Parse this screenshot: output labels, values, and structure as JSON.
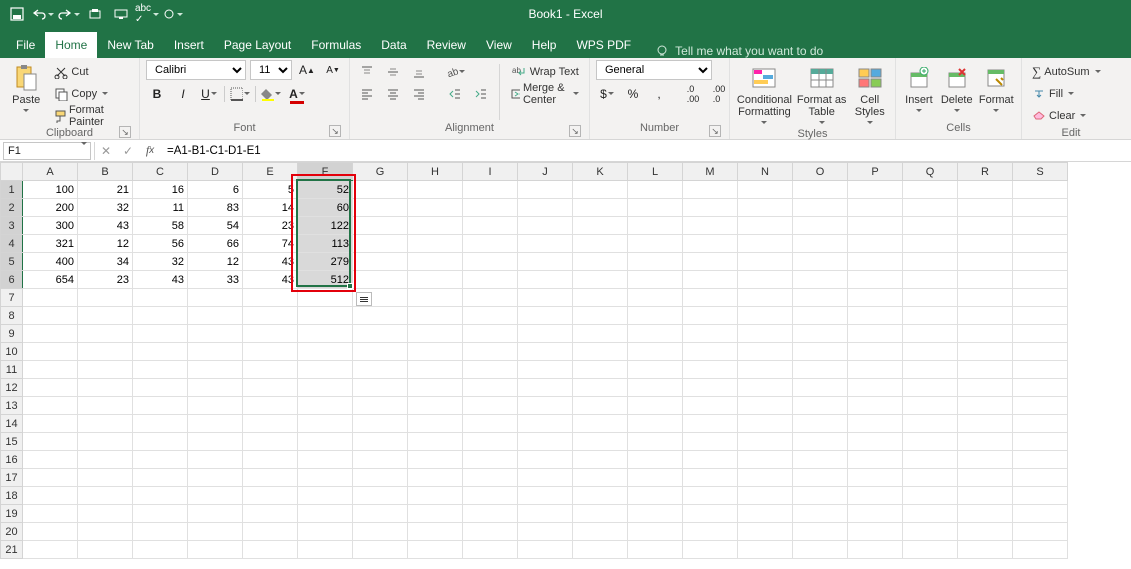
{
  "app": {
    "title": "Book1 - Excel"
  },
  "qat": {
    "save": "save-icon",
    "undo": "undo-icon",
    "redo": "redo-icon",
    "preview": "print-preview-icon",
    "device": "device-icon",
    "spellcheck": "spellcheck-icon",
    "touchmode": "touch-mode-icon"
  },
  "tabs": {
    "file": "File",
    "items": [
      "Home",
      "New Tab",
      "Insert",
      "Page Layout",
      "Formulas",
      "Data",
      "Review",
      "View",
      "Help",
      "WPS PDF"
    ],
    "active_index": 0,
    "tell_me": "Tell me what you want to do"
  },
  "ribbon": {
    "clipboard": {
      "label": "Clipboard",
      "paste": "Paste",
      "cut": "Cut",
      "copy": "Copy",
      "format_painter": "Format Painter"
    },
    "font": {
      "label": "Font",
      "name_value": "Calibri",
      "size_value": "11",
      "bold": "B",
      "italic": "I",
      "underline": "U"
    },
    "alignment": {
      "label": "Alignment",
      "wrap": "Wrap Text",
      "merge": "Merge & Center"
    },
    "number": {
      "label": "Number",
      "format_value": "General",
      "currency": "$",
      "percent": "%",
      "comma": ","
    },
    "styles": {
      "label": "Styles",
      "cond": "Conditional\nFormatting",
      "table": "Format as\nTable",
      "cell": "Cell\nStyles"
    },
    "cells": {
      "label": "Cells",
      "insert": "Insert",
      "delete": "Delete",
      "format": "Format"
    },
    "editing": {
      "label": "Edit",
      "autosum": "AutoSum",
      "fill": "Fill",
      "clear": "Clear"
    }
  },
  "formula_bar": {
    "name_box": "F1",
    "formula": "=A1-B1-C1-D1-E1"
  },
  "grid": {
    "columns": [
      "A",
      "B",
      "C",
      "D",
      "E",
      "F",
      "G",
      "H",
      "I",
      "J",
      "K",
      "L",
      "M",
      "N",
      "O",
      "P",
      "Q",
      "R",
      "S"
    ],
    "rows_shown": 21,
    "selected_col": "F",
    "selected_rows": [
      1,
      6
    ],
    "data": [
      [
        100,
        21,
        16,
        6,
        5,
        52
      ],
      [
        200,
        32,
        11,
        83,
        14,
        60
      ],
      [
        300,
        43,
        58,
        54,
        23,
        122
      ],
      [
        321,
        12,
        56,
        66,
        74,
        113
      ],
      [
        400,
        34,
        32,
        12,
        43,
        279
      ],
      [
        654,
        23,
        43,
        33,
        43,
        512
      ]
    ]
  },
  "chart_data": {
    "type": "table",
    "columns": [
      "A",
      "B",
      "C",
      "D",
      "E",
      "F"
    ],
    "rows": [
      [
        100,
        21,
        16,
        6,
        5,
        52
      ],
      [
        200,
        32,
        11,
        83,
        14,
        60
      ],
      [
        300,
        43,
        58,
        54,
        23,
        122
      ],
      [
        321,
        12,
        56,
        66,
        74,
        113
      ],
      [
        400,
        34,
        32,
        12,
        43,
        279
      ],
      [
        654,
        23,
        43,
        33,
        43,
        512
      ]
    ],
    "note": "Column F computed as =A-B-C-D-E for each row"
  }
}
